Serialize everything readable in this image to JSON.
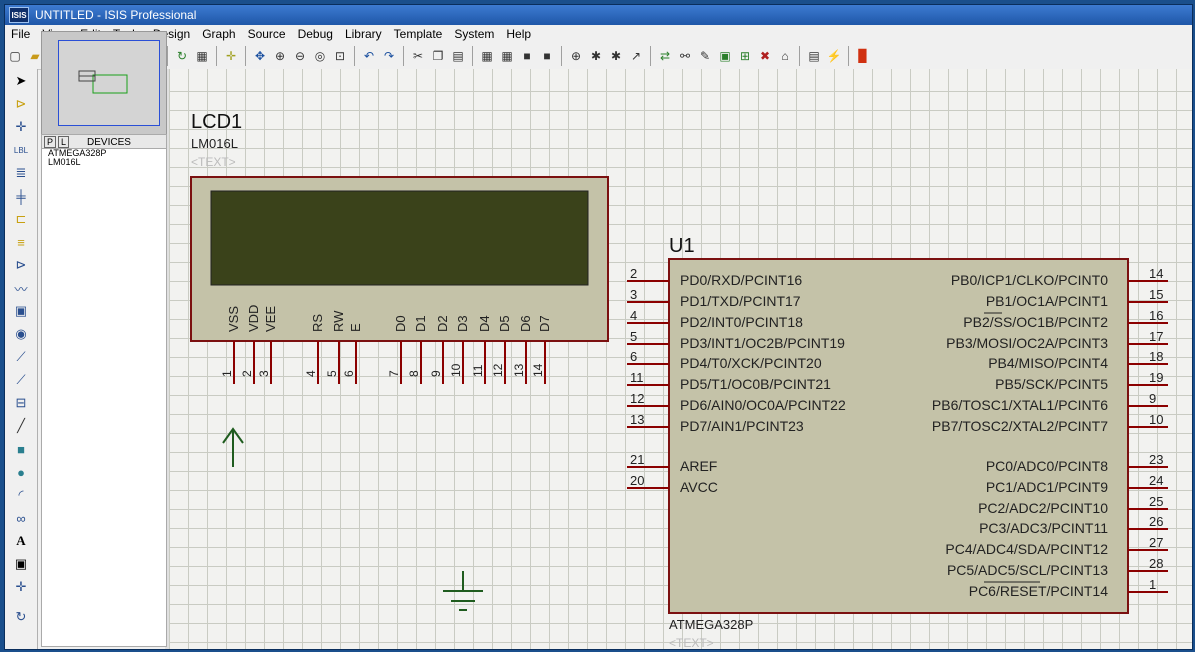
{
  "window": {
    "title": "UNTITLED - ISIS Professional",
    "logo": "ISIS"
  },
  "menu": [
    "File",
    "View",
    "Edit",
    "Tools",
    "Design",
    "Graph",
    "Source",
    "Debug",
    "Library",
    "Template",
    "System",
    "Help"
  ],
  "device_panel": {
    "tab_p": "P",
    "tab_l": "L",
    "header": "DEVICES",
    "items": [
      "ATMEGA328P",
      "LM016L"
    ]
  },
  "lcd": {
    "ref": "LCD1",
    "part": "LM016L",
    "text": "<TEXT>",
    "pin_labels": [
      "VSS",
      "VDD",
      "VEE",
      "RS",
      "RW",
      "E",
      "D0",
      "D1",
      "D2",
      "D3",
      "D4",
      "D5",
      "D6",
      "D7"
    ],
    "pin_numbers": [
      "1",
      "2",
      "3",
      "4",
      "5",
      "6",
      "7",
      "8",
      "9",
      "10",
      "11",
      "12",
      "13",
      "14"
    ],
    "screen_color": "#3a421a"
  },
  "mcu": {
    "ref": "U1",
    "part": "ATMEGA328P",
    "text": "<TEXT>",
    "left_pins": [
      {
        "num": "2",
        "label": "PD0/RXD/PCINT16"
      },
      {
        "num": "3",
        "label": "PD1/TXD/PCINT17"
      },
      {
        "num": "4",
        "label": "PD2/INT0/PCINT18"
      },
      {
        "num": "5",
        "label": "PD3/INT1/OC2B/PCINT19"
      },
      {
        "num": "6",
        "label": "PD4/T0/XCK/PCINT20"
      },
      {
        "num": "11",
        "label": "PD5/T1/OC0B/PCINT21"
      },
      {
        "num": "12",
        "label": "PD6/AIN0/OC0A/PCINT22"
      },
      {
        "num": "13",
        "label": "PD7/AIN1/PCINT23"
      },
      {
        "num": "21",
        "label": "AREF"
      },
      {
        "num": "20",
        "label": "AVCC"
      }
    ],
    "right_pins": [
      {
        "num": "14",
        "label": "PB0/ICP1/CLKO/PCINT0"
      },
      {
        "num": "15",
        "label": "PB1/OC1A/PCINT1"
      },
      {
        "num": "16",
        "label": "PB2/SS/OC1B/PCINT2"
      },
      {
        "num": "17",
        "label": "PB3/MOSI/OC2A/PCINT3"
      },
      {
        "num": "18",
        "label": "PB4/MISO/PCINT4"
      },
      {
        "num": "19",
        "label": "PB5/SCK/PCINT5"
      },
      {
        "num": "9",
        "label": "PB6/TOSC1/XTAL1/PCINT6"
      },
      {
        "num": "10",
        "label": "PB7/TOSC2/XTAL2/PCINT7"
      },
      {
        "num": "23",
        "label": "PC0/ADC0/PCINT8"
      },
      {
        "num": "24",
        "label": "PC1/ADC1/PCINT9"
      },
      {
        "num": "25",
        "label": "PC2/ADC2/PCINT10"
      },
      {
        "num": "26",
        "label": "PC3/ADC3/PCINT11"
      },
      {
        "num": "27",
        "label": "PC4/ADC4/SDA/PCINT12"
      },
      {
        "num": "28",
        "label": "PC5/ADC5/SCL/PCINT13"
      },
      {
        "num": "1",
        "label": "PC6/RESET/PCINT14"
      }
    ]
  },
  "colors": {
    "component_fill": "#c4c2a8",
    "component_stroke": "#7b1010",
    "pin_color": "#8b0000",
    "power_color": "#1f5c1f"
  }
}
